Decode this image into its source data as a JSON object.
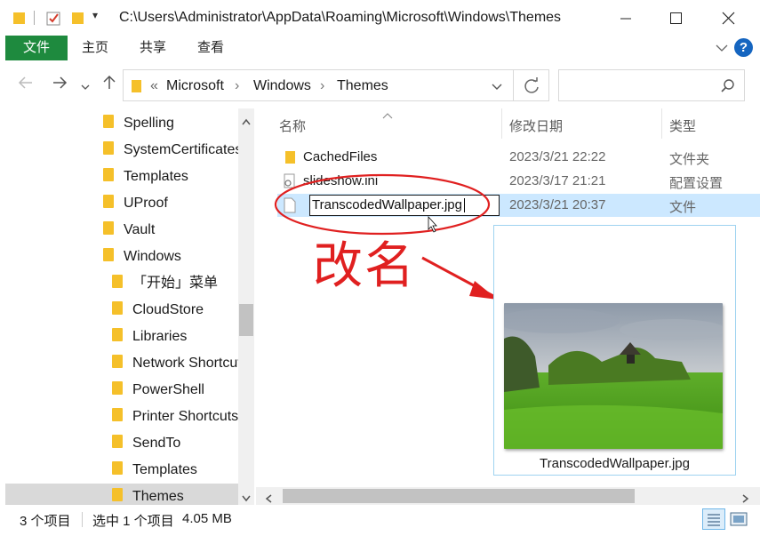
{
  "window": {
    "path": "C:\\Users\\Administrator\\AppData\\Roaming\\Microsoft\\Windows\\Themes"
  },
  "ribbon": {
    "tabs": [
      "文件",
      "主页",
      "共享",
      "查看"
    ]
  },
  "address": {
    "overflow": "«",
    "crumbs": [
      "Microsoft",
      "Windows",
      "Themes"
    ]
  },
  "search": {
    "placeholder": ""
  },
  "nav_tree": [
    {
      "label": "Spelling",
      "selected": false
    },
    {
      "label": "SystemCertificates",
      "selected": false
    },
    {
      "label": "Templates",
      "selected": false
    },
    {
      "label": "UProof",
      "selected": false
    },
    {
      "label": "Vault",
      "selected": false
    },
    {
      "label": "Windows",
      "selected": false
    },
    {
      "label": "「开始」菜单",
      "selected": false
    },
    {
      "label": "CloudStore",
      "selected": false
    },
    {
      "label": "Libraries",
      "selected": false
    },
    {
      "label": "Network Shortcuts",
      "selected": false
    },
    {
      "label": "PowerShell",
      "selected": false
    },
    {
      "label": "Printer Shortcuts",
      "selected": false
    },
    {
      "label": "SendTo",
      "selected": false
    },
    {
      "label": "Templates",
      "selected": false
    },
    {
      "label": "Themes",
      "selected": true
    }
  ],
  "columns": {
    "name": "名称",
    "date": "修改日期",
    "type": "类型"
  },
  "files": [
    {
      "name": "CachedFiles",
      "date": "2023/3/21 22:22",
      "type": "文件夹",
      "icon": "folder-icon"
    },
    {
      "name": "slideshow.ini",
      "date": "2023/3/17 21:21",
      "type": "配置设置",
      "icon": "settings-file-icon"
    },
    {
      "name": "TranscodedWallpaper.jpg",
      "date": "2023/3/21 20:37",
      "type": "文件",
      "icon": "file-icon",
      "renaming": true
    }
  ],
  "preview": {
    "label": "TranscodedWallpaper.jpg"
  },
  "annotation": {
    "text": "改名"
  },
  "status": {
    "count": "3 个项目",
    "selected": "选中 1 个项目",
    "size": "4.05 MB"
  },
  "colors": {
    "accent_file_tab": "#1e8a3e",
    "selection": "#cce8ff",
    "annotation": "#e02020",
    "folder": "#f5c02a"
  }
}
